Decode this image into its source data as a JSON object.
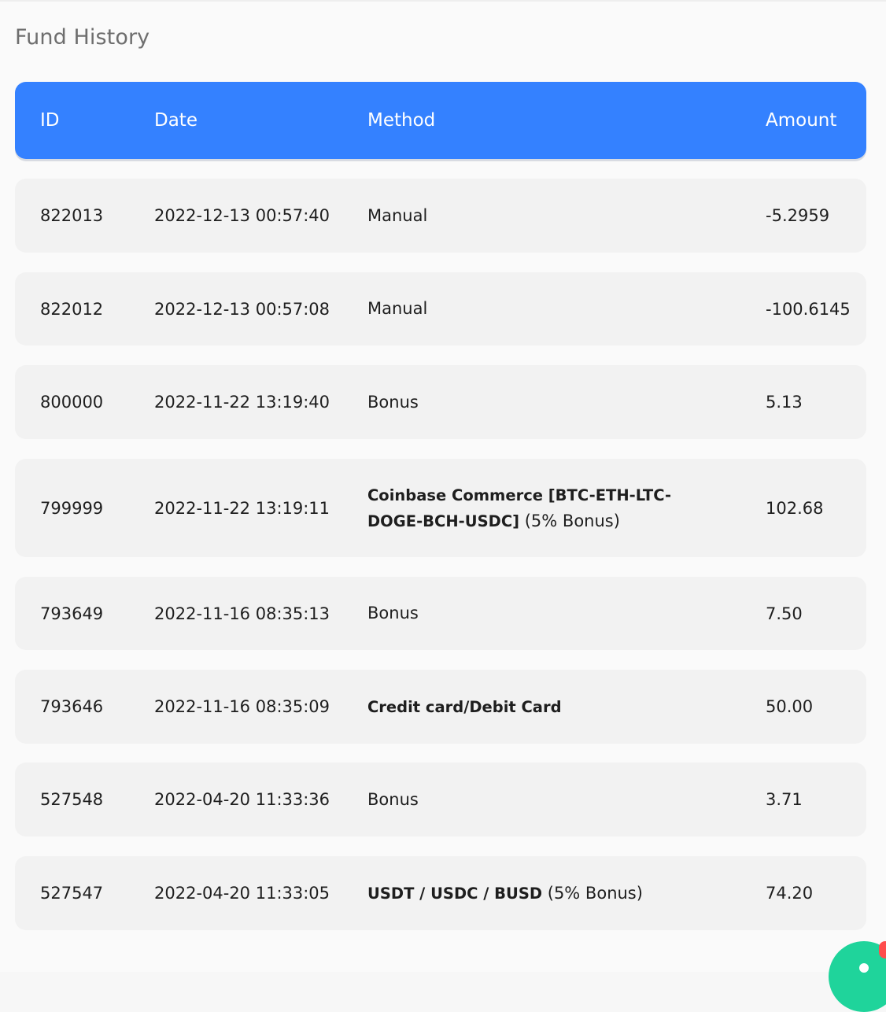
{
  "page": {
    "title": "Fund History"
  },
  "table": {
    "headers": {
      "id": "ID",
      "date": "Date",
      "method": "Method",
      "amount": "Amount"
    },
    "rows": [
      {
        "id": "822013",
        "date": "2022-12-13 00:57:40",
        "method_prefix": "",
        "method_bold": "",
        "method_suffix": "Manual",
        "amount": "-5.2959"
      },
      {
        "id": "822012",
        "date": "2022-12-13 00:57:08",
        "method_prefix": "",
        "method_bold": "",
        "method_suffix": "Manual",
        "amount": "-100.6145"
      },
      {
        "id": "800000",
        "date": "2022-11-22 13:19:40",
        "method_prefix": "",
        "method_bold": "",
        "method_suffix": "Bonus",
        "amount": "5.13"
      },
      {
        "id": "799999",
        "date": "2022-11-22 13:19:11",
        "method_prefix": "",
        "method_bold": "Coinbase Commerce [BTC-ETH-LTC-DOGE-BCH-USDC]",
        "method_suffix": " (5% Bonus)",
        "amount": "102.68"
      },
      {
        "id": "793649",
        "date": "2022-11-16 08:35:13",
        "method_prefix": "",
        "method_bold": "",
        "method_suffix": "Bonus",
        "amount": "7.50"
      },
      {
        "id": "793646",
        "date": "2022-11-16 08:35:09",
        "method_prefix": "",
        "method_bold": "Credit card/Debit Card",
        "method_suffix": "",
        "amount": "50.00"
      },
      {
        "id": "527548",
        "date": "2022-04-20 11:33:36",
        "method_prefix": "",
        "method_bold": "",
        "method_suffix": "Bonus",
        "amount": "3.71"
      },
      {
        "id": "527547",
        "date": "2022-04-20 11:33:05",
        "method_prefix": "",
        "method_bold": "USDT / USDC / BUSD",
        "method_suffix": " (5% Bonus)",
        "amount": "74.20"
      }
    ]
  },
  "floating_button": {
    "icon": "chat-icon",
    "color": "#1fd49b",
    "badge_color": "#ff4d4d"
  },
  "colors": {
    "header_bg": "#3481ff",
    "row_bg": "#f2f2f2",
    "page_bg": "#fafafa"
  }
}
